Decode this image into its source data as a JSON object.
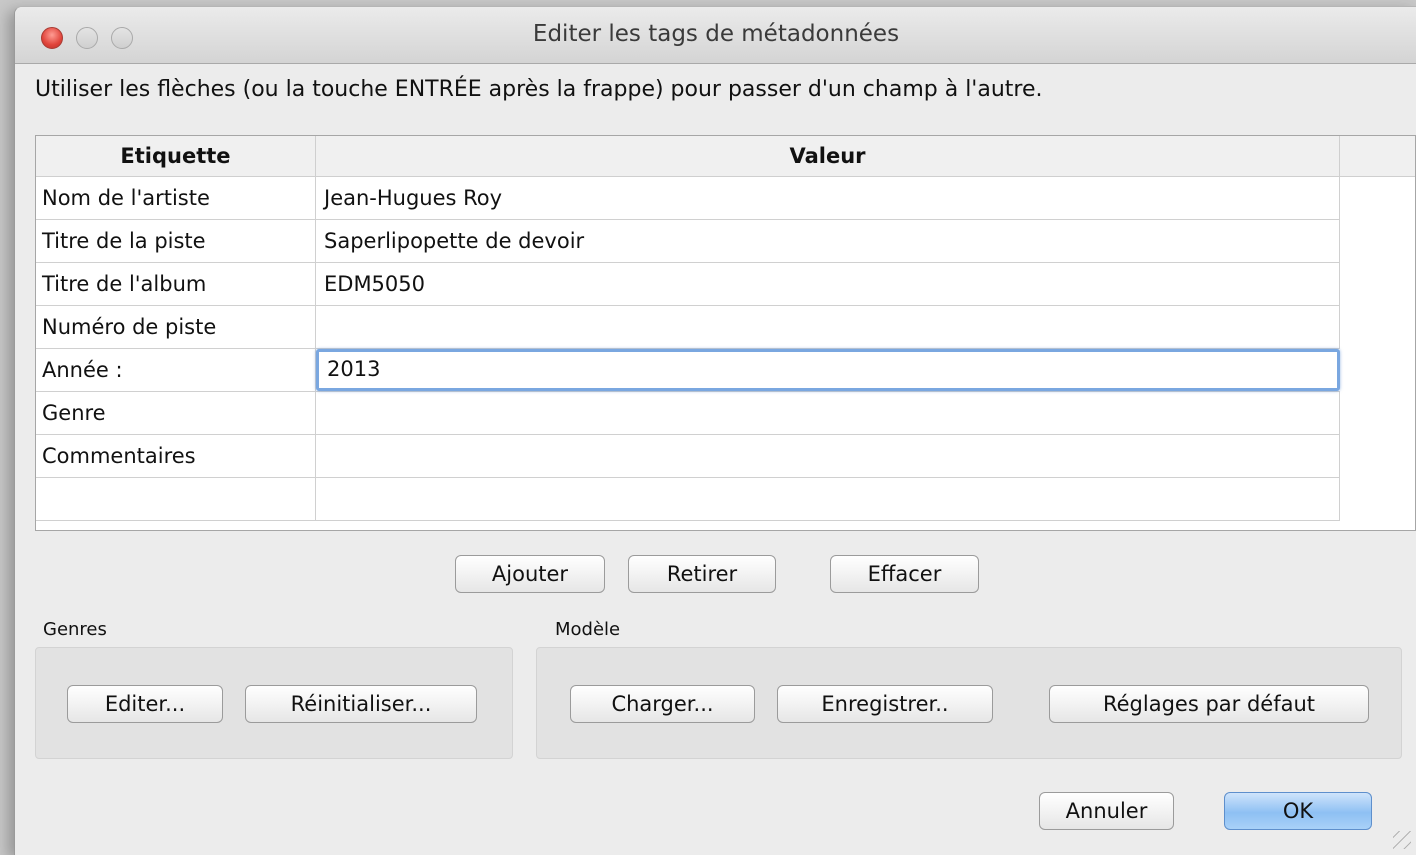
{
  "window": {
    "title": "Editer les tags de métadonnées"
  },
  "instruction": "Utiliser les flèches (ou la touche ENTRÉE après la frappe) pour passer d'un champ à l'autre.",
  "table": {
    "headers": {
      "label": "Etiquette",
      "value": "Valeur"
    },
    "rows": [
      {
        "label": "Nom de l'artiste",
        "value": "Jean-Hugues Roy"
      },
      {
        "label": "Titre de la piste",
        "value": "Saperlipopette de devoir"
      },
      {
        "label": "Titre de l'album",
        "value": "EDM5050"
      },
      {
        "label": "Numéro de piste",
        "value": ""
      },
      {
        "label": "Année :",
        "value": "2013"
      },
      {
        "label": "Genre",
        "value": ""
      },
      {
        "label": "Commentaires",
        "value": ""
      },
      {
        "label": "",
        "value": ""
      }
    ],
    "editing_row": 4
  },
  "row_buttons": {
    "add": "Ajouter",
    "remove": "Retirer",
    "clear": "Effacer"
  },
  "genres": {
    "label": "Genres",
    "edit": "Editer...",
    "reset": "Réinitialiser..."
  },
  "template": {
    "label": "Modèle",
    "load": "Charger...",
    "save": "Enregistrer..",
    "defaults": "Réglages par défaut"
  },
  "footer": {
    "cancel": "Annuler",
    "ok": "OK"
  },
  "colors": {
    "focus_ring": "#7aa7e0",
    "default_button": "#8ec0f3"
  }
}
